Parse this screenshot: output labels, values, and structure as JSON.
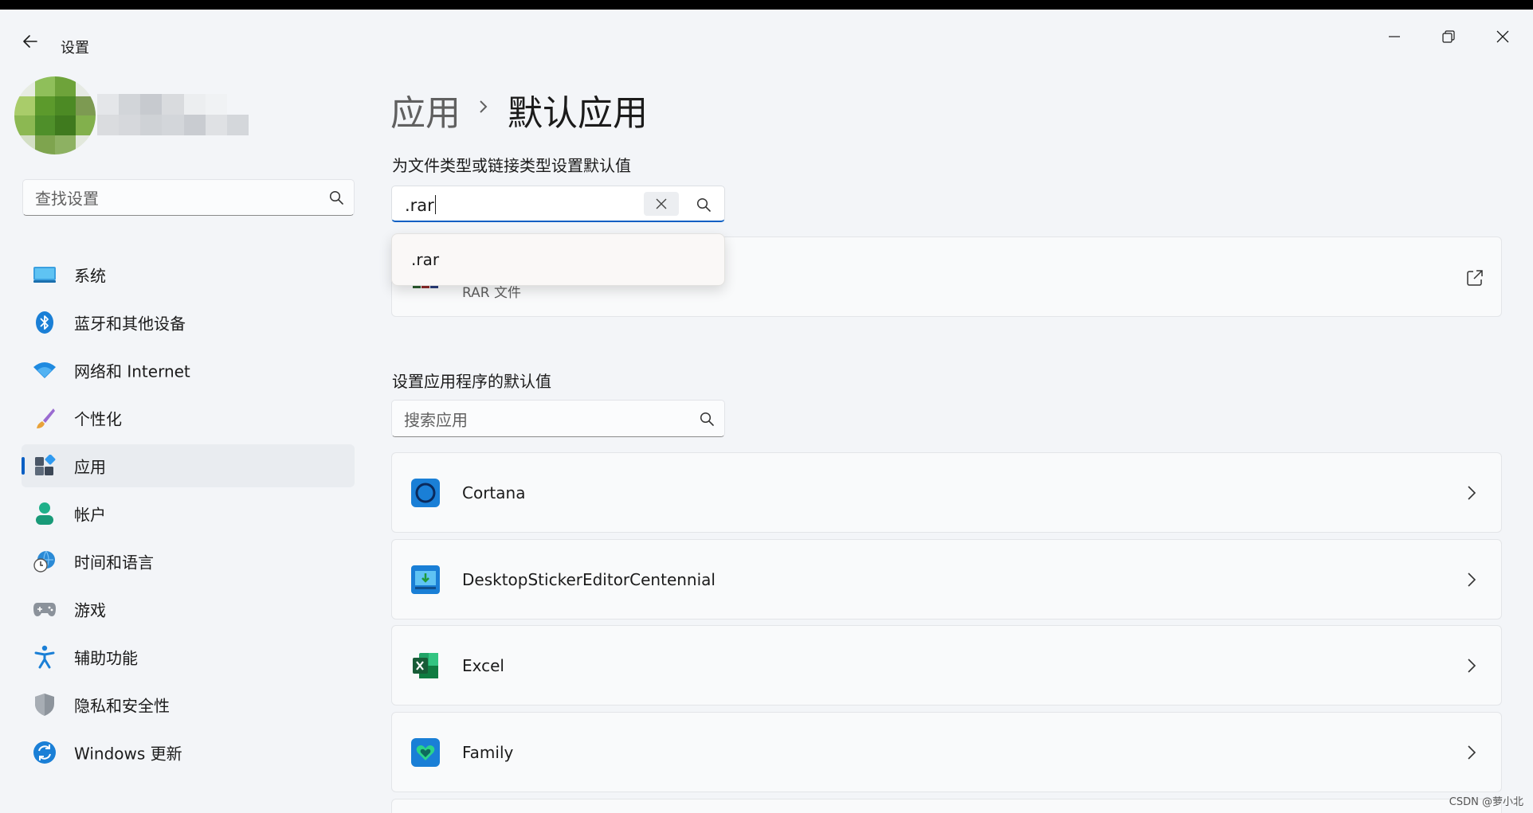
{
  "window": {
    "title": "设置",
    "controls": {
      "minimize": "minimize-icon",
      "maximize": "restore-icon",
      "close": "close-icon"
    }
  },
  "sidebar": {
    "search_placeholder": "查找设置",
    "items": [
      {
        "label": "系统",
        "icon": "system-display-icon",
        "selected": false
      },
      {
        "label": "蓝牙和其他设备",
        "icon": "bluetooth-icon",
        "selected": false
      },
      {
        "label": "网络和 Internet",
        "icon": "wifi-icon",
        "selected": false
      },
      {
        "label": "个性化",
        "icon": "brush-icon",
        "selected": false
      },
      {
        "label": "应用",
        "icon": "apps-icon",
        "selected": true
      },
      {
        "label": "帐户",
        "icon": "account-icon",
        "selected": false
      },
      {
        "label": "时间和语言",
        "icon": "time-language-icon",
        "selected": false
      },
      {
        "label": "游戏",
        "icon": "gamepad-icon",
        "selected": false
      },
      {
        "label": "辅助功能",
        "icon": "accessibility-icon",
        "selected": false
      },
      {
        "label": "隐私和安全性",
        "icon": "shield-icon",
        "selected": false
      },
      {
        "label": "Windows 更新",
        "icon": "windows-update-icon",
        "selected": false
      }
    ]
  },
  "main": {
    "breadcrumb": {
      "parent": "应用",
      "current": "默认应用"
    },
    "filetype_section": {
      "title": "为文件类型或链接类型设置默认值",
      "input_value": ".rar",
      "suggestion": ".rar",
      "result": {
        "description": "RAR 文件"
      }
    },
    "apps_section": {
      "title": "设置应用程序的默认值",
      "search_placeholder": "搜索应用",
      "apps": [
        {
          "name": "Cortana",
          "icon": "cortana-icon"
        },
        {
          "name": "DesktopStickerEditorCentennial",
          "icon": "sticker-editor-icon"
        },
        {
          "name": "Excel",
          "icon": "excel-icon"
        },
        {
          "name": "Family",
          "icon": "family-icon"
        }
      ]
    }
  },
  "watermark": "CSDN @萝小北",
  "colors": {
    "accent": "#0a5fc4",
    "background": "#f3f5f8"
  }
}
